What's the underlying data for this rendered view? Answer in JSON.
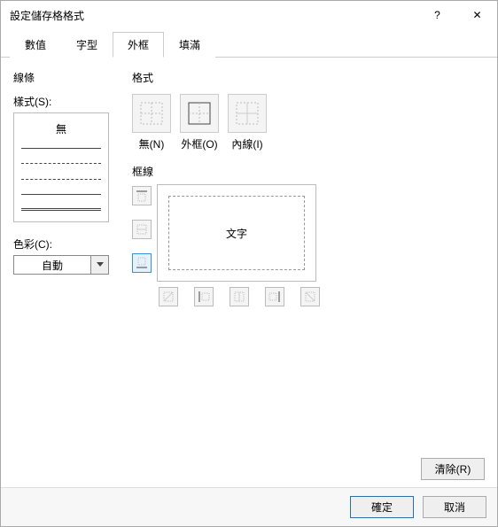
{
  "window": {
    "title": "設定儲存格格式",
    "help": "?",
    "close": "✕"
  },
  "tabs": {
    "number": "數值",
    "font": "字型",
    "border": "外框",
    "fill": "填滿"
  },
  "left": {
    "lines_header": "線條",
    "style_label": "樣式(S):",
    "none": "無",
    "color_label": "色彩(C):",
    "color_value": "自動"
  },
  "presets": {
    "header": "格式",
    "none_label": "無(N)",
    "outline_label": "外框(O)",
    "inside_label": "內線(I)"
  },
  "borders": {
    "header": "框線",
    "preview_text": "文字"
  },
  "buttons": {
    "clear": "清除(R)",
    "ok": "確定",
    "cancel": "取消"
  }
}
